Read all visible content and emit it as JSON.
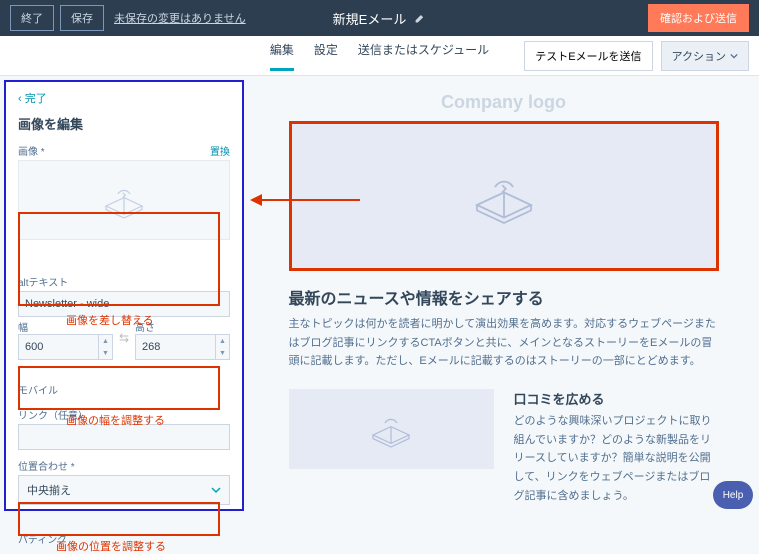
{
  "topbar": {
    "exit": "終了",
    "save": "保存",
    "unsaved": "未保存の変更はありません",
    "title": "新規Eメール",
    "confirm": "確認および送信"
  },
  "subbar": {
    "tabs": {
      "edit": "編集",
      "settings": "設定",
      "schedule": "送信またはスケジュール"
    },
    "test": "テストEメールを送信",
    "actions": "アクション"
  },
  "sidebar": {
    "back": "完了",
    "title": "画像を編集",
    "image_label": "画像 *",
    "replace": "置換",
    "alt_label": "altテキスト",
    "alt_value": "Newsletter - wide",
    "width_label": "幅",
    "height_label": "高さ",
    "width_value": "600",
    "height_value": "268",
    "mobile_label": "モバイル",
    "link_label": "リンク（任意）",
    "align_label": "位置合わせ *",
    "align_value": "中央揃え",
    "padding_label": "パディング"
  },
  "annotations": {
    "replace_hint": "画像を差し替える",
    "width_hint": "画像の幅を調整する",
    "align_hint": "画像の位置を調整する"
  },
  "preview": {
    "logo": "Company logo",
    "h2": "最新のニュースや情報をシェアする",
    "p": "主なトピックは何かを読者に明かして演出効果を高めます。対応するウェブページまたはブログ記事にリンクするCTAボタンと共に、メインとなるストーリーをEメールの冒頭に記載します。ただし、Eメールに記載するのはストーリーの一部にとどめます。",
    "h3": "口コミを広める",
    "p2": "どのような興味深いプロジェクトに取り組んでいますか？どのような新製品をリリースしていますか？簡単な説明を公開して、リンクをウェブページまたはブログ記事に含めましょう。"
  },
  "help": "Help"
}
